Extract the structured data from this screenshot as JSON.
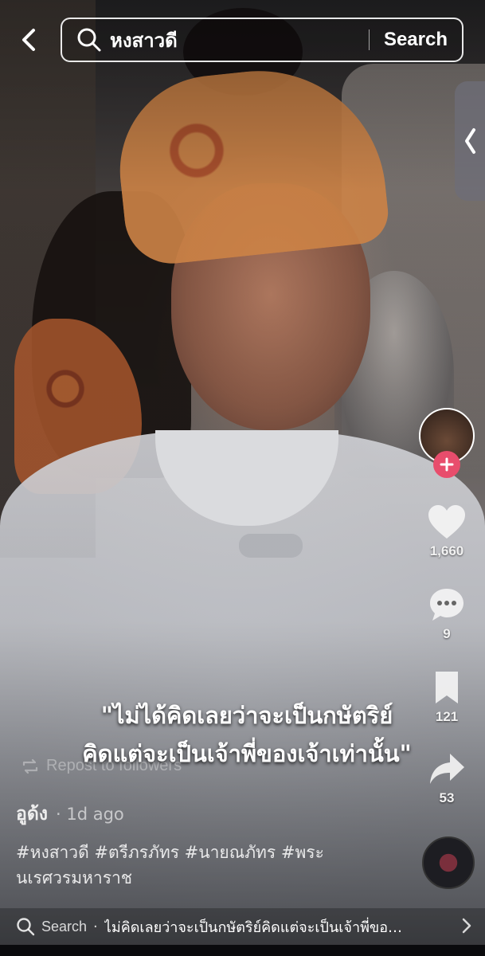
{
  "header": {
    "search_query": "หงสาวดี",
    "search_button": "Search"
  },
  "caption_lines": [
    "\"ไม่ได้คิดเลยว่าจะเป็นกษัตริย์",
    "คิดแต่จะเป็นเจ้าพี่ของเจ้าเท่านั้น\""
  ],
  "actions": {
    "likes": "1,660",
    "comments": "9",
    "saves": "121",
    "shares": "53"
  },
  "post": {
    "repost_label": "Repost to followers",
    "author": "อูด้ง",
    "time": "· 1d ago",
    "hashtags": "#หงสาวดี #ตรีภรภัทร #นายณภัทร #พระนเรศวรมหาราช"
  },
  "bottom_search": {
    "label": "Search",
    "separator": "·",
    "text": "ไม่คิดเลยว่าจะเป็นกษัตริย์คิดแต่จะเป็นเจ้าพี่ของเจ้า..."
  },
  "colors": {
    "follow_badge": "#e84d6c",
    "text": "#ffffff"
  }
}
